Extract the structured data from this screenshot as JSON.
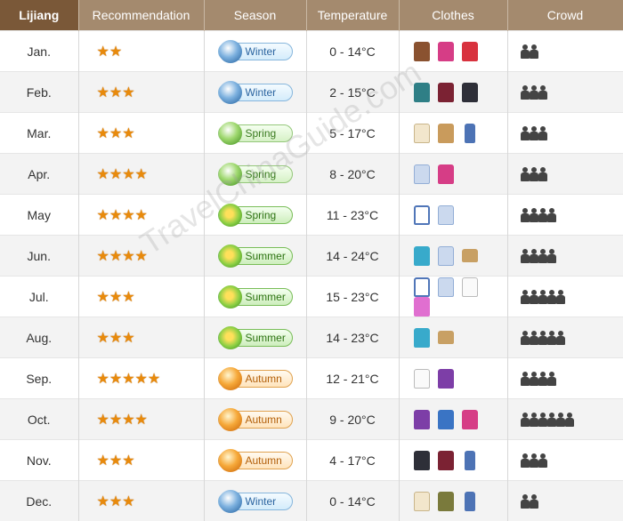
{
  "header": {
    "place": "Lijiang",
    "recommendation": "Recommendation",
    "season": "Season",
    "temperature": "Temperature",
    "clothes": "Clothes",
    "crowd": "Crowd"
  },
  "watermark": "TravelChinaGuide.com",
  "rows": [
    {
      "month": "Jan.",
      "stars": 2,
      "season": "Winter",
      "season_type": "winter",
      "temp": "0 - 14°C",
      "clothes": [
        "jacket-brown",
        "hoodie-pink",
        "jacket-red"
      ],
      "crowd": 2
    },
    {
      "month": "Feb.",
      "stars": 3,
      "season": "Winter",
      "season_type": "winter",
      "temp": "2 - 15°C",
      "clothes": [
        "sweater-teal",
        "varsity",
        "jacket-black"
      ],
      "crowd": 3
    },
    {
      "month": "Mar.",
      "stars": 3,
      "season": "Spring",
      "season_type": "spring",
      "temp": "5 - 17°C",
      "clothes": [
        "sweater-cream",
        "coat-tan",
        "jeans"
      ],
      "crowd": 3
    },
    {
      "month": "Apr.",
      "stars": 4,
      "season": "Spring",
      "season_type": "spring",
      "temp": "8 - 20°C",
      "clothes": [
        "shirt-blue",
        "hoodie-pink"
      ],
      "crowd": 3
    },
    {
      "month": "May",
      "stars": 4,
      "season": "Spring",
      "season_type": "summer",
      "temp": "11 - 23°C",
      "clothes": [
        "tee-raglan",
        "shirt-blue"
      ],
      "crowd": 4
    },
    {
      "month": "Jun.",
      "stars": 4,
      "season": "Summer",
      "season_type": "summer",
      "temp": "14 - 24°C",
      "clothes": [
        "tee-cyan",
        "shirt-blue",
        "shorts"
      ],
      "crowd": 4
    },
    {
      "month": "Jul.",
      "stars": 3,
      "season": "Summer",
      "season_type": "summer",
      "temp": "15 - 23°C",
      "clothes": [
        "tee-raglan",
        "shirt-blue",
        "shirt-white",
        "dress-pink"
      ],
      "crowd": 5
    },
    {
      "month": "Aug.",
      "stars": 3,
      "season": "Summer",
      "season_type": "summer",
      "temp": "14 - 23°C",
      "clothes": [
        "tee-cyan",
        "shorts"
      ],
      "crowd": 5
    },
    {
      "month": "Sep.",
      "stars": 5,
      "season": "Autumn",
      "season_type": "autumn",
      "temp": "12 - 21°C",
      "clothes": [
        "shirt-white",
        "sweater-purple"
      ],
      "crowd": 4
    },
    {
      "month": "Oct.",
      "stars": 4,
      "season": "Autumn",
      "season_type": "autumn",
      "temp": "9 - 20°C",
      "clothes": [
        "sweater-purple",
        "jacket-blue",
        "hoodie-pink"
      ],
      "crowd": 6
    },
    {
      "month": "Nov.",
      "stars": 3,
      "season": "Autumn",
      "season_type": "autumn",
      "temp": "4 - 17°C",
      "clothes": [
        "jacket-black",
        "varsity",
        "jeans"
      ],
      "crowd": 3
    },
    {
      "month": "Dec.",
      "stars": 3,
      "season": "Winter",
      "season_type": "winter",
      "temp": "0 - 14°C",
      "clothes": [
        "sweater-cream",
        "parka-olive",
        "jeans"
      ],
      "crowd": 2
    }
  ]
}
